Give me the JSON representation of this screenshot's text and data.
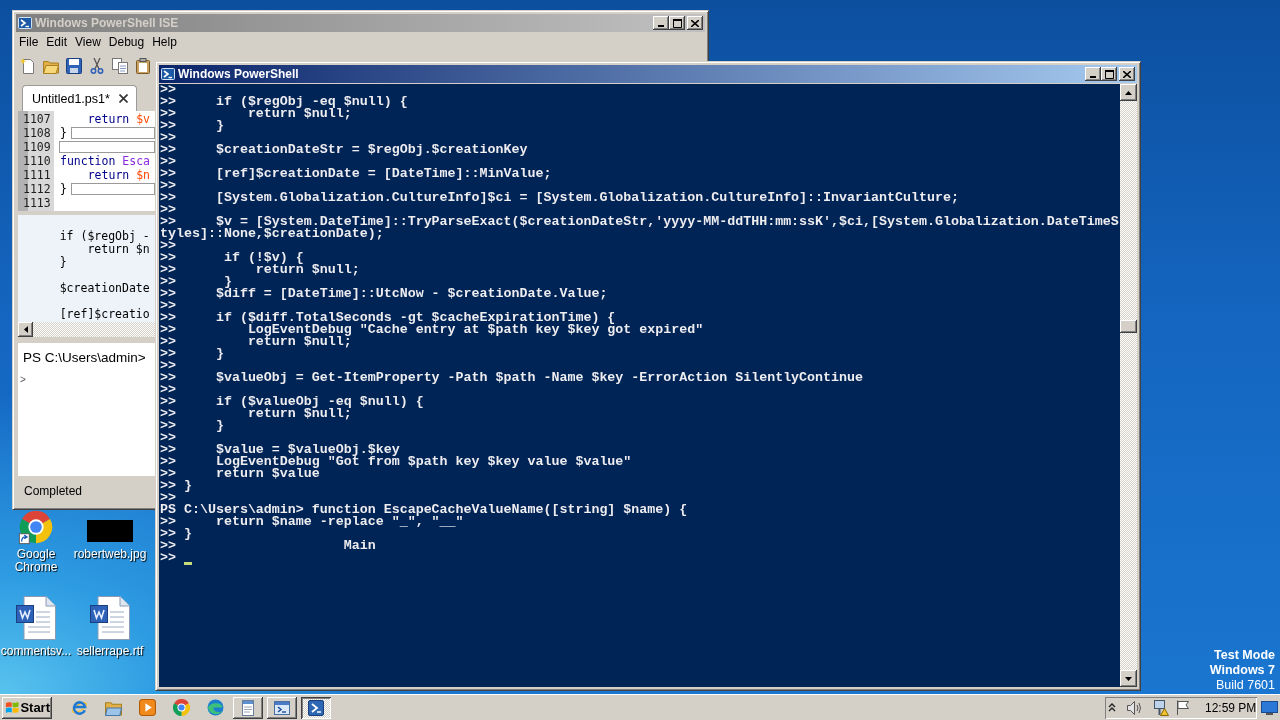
{
  "ise_window": {
    "title": "Windows PowerShell ISE",
    "active": false,
    "menu": [
      "File",
      "Edit",
      "View",
      "Debug",
      "Help"
    ],
    "tabs": [
      {
        "label": "Untitled1.ps1*",
        "selected": true
      }
    ],
    "editor_lines": [
      {
        "number": "1107",
        "boxed": false,
        "tokens": [
          {
            "text": "    return",
            "kind": "keyword"
          },
          {
            "text": " $v",
            "kind": "variable"
          }
        ]
      },
      {
        "number": "1108",
        "boxed": true,
        "tokens": [
          {
            "text": "}",
            "kind": "plain"
          }
        ]
      },
      {
        "number": "1109",
        "boxed": true
      },
      {
        "number": "1110",
        "boxed": false,
        "tokens": [
          {
            "text": "function",
            "kind": "keyword"
          },
          {
            "text": " Esca",
            "kind": "command"
          }
        ]
      },
      {
        "number": "1111",
        "boxed": false,
        "tokens": [
          {
            "text": "    return",
            "kind": "keyword"
          },
          {
            "text": " $n",
            "kind": "variable"
          }
        ]
      },
      {
        "number": "1112",
        "boxed": true,
        "tokens": [
          {
            "text": "}",
            "kind": "plain"
          }
        ]
      },
      {
        "number": "1113",
        "boxed": false
      }
    ],
    "script_pane": {
      "blocks": [
        [
          "    if ($regObj -",
          "        return $n",
          "    }"
        ],
        [
          "    $creationDate"
        ],
        [
          "    [ref]$creatio"
        ]
      ]
    },
    "console_pane": {
      "prompt": "PS C:\\Users\\admin>",
      "input_marker": ">"
    },
    "status": "Completed"
  },
  "console_window": {
    "title": "Windows PowerShell",
    "active": true,
    "lines": [
      ">>",
      ">>     if ($regObj -eq $null) {",
      ">>         return $null;",
      ">>     }",
      ">>",
      ">>     $creationDateStr = $regObj.$creationKey",
      ">>",
      ">>     [ref]$creationDate = [DateTime]::MinValue;",
      ">>",
      ">>     [System.Globalization.CultureInfo]$ci = [System.Globalization.CultureInfo]::InvariantCulture;",
      ">>",
      ">>     $v = [System.DateTime]::TryParseExact($creationDateStr,'yyyy-MM-ddTHH:mm:ssK',$ci,[System.Globalization.DateTimeS",
      "tyles]::None,$creationDate);",
      ">>",
      ">>      if (!$v) {",
      ">>          return $null;",
      ">>      }",
      ">>     $diff = [DateTime]::UtcNow - $creationDate.Value;",
      ">>",
      ">>     if ($diff.TotalSeconds -gt $cacheExpirationTime) {",
      ">>         LogEventDebug \"Cache entry at $path key $key got expired\"",
      ">>         return $null;",
      ">>     }",
      ">>",
      ">>     $valueObj = Get-ItemProperty -Path $path -Name $key -ErrorAction SilentlyContinue",
      ">>",
      ">>     if ($valueObj -eq $null) {",
      ">>         return $null;",
      ">>     }",
      ">>",
      ">>     $value = $valueObj.$key",
      ">>     LogEventDebug \"Got from $path key $key value $value\"",
      ">>     return $value",
      ">> }",
      ">>",
      "PS C:\\Users\\admin> function EscapeCacheValueName([string] $name) {",
      ">>     return $name -replace \"_\", \"__\"",
      ">> }",
      ">>                     Main",
      ">>"
    ]
  },
  "desktop": {
    "icons": [
      "Google Chrome",
      "robertweb.jpg",
      "commentsv...",
      "sellerrape.rtf"
    ],
    "notice": [
      "Test Mode",
      "Windows 7",
      "Build 7601"
    ]
  },
  "taskbar": {
    "start": "Start",
    "tasks": [
      {
        "selected": false
      },
      {
        "selected": false
      },
      {
        "selected": true
      }
    ],
    "clock": "12:59 PM"
  }
}
